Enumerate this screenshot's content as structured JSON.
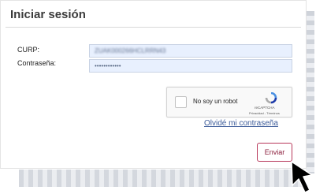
{
  "login": {
    "title": "Iniciar sesión",
    "curp_label": "CURP:",
    "curp_value": "ZUAK000266HCLRRN43",
    "password_label": "Contraseña:",
    "password_value": "••••••••••••",
    "recaptcha": {
      "label": "No soy un robot",
      "brand": "reCAPTCHA",
      "links": "Privacidad - Términos",
      "icon": "recaptcha-logo-icon"
    },
    "forgot_link": "Olvidé mi contraseña",
    "submit_label": "Enviar"
  },
  "colors": {
    "field_bg": "#e8f0fe",
    "submit_border": "#b8385a",
    "link": "#3d5c9a"
  },
  "cursor_icon": "arrow-pointer-icon"
}
